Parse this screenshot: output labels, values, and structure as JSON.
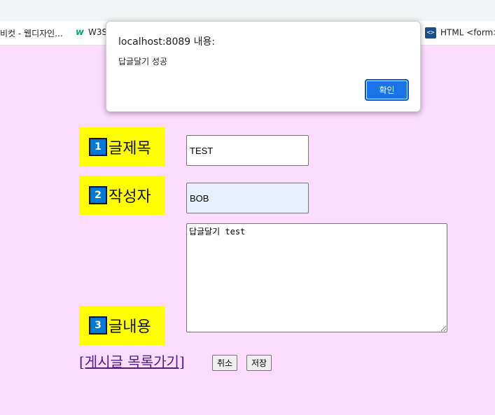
{
  "browser": {
    "bookmarks": [
      {
        "label": "비컷 - 웹디자인..."
      },
      {
        "label": "W3S",
        "icon": "w3schools-icon"
      },
      {
        "label": "HTML <form>",
        "icon": "code-icon"
      }
    ]
  },
  "form": {
    "fields": [
      {
        "num": "1",
        "label": "글제목",
        "value": "TEST"
      },
      {
        "num": "2",
        "label": "작성자",
        "value": "BOB"
      },
      {
        "num": "3",
        "label": "글내용",
        "value": "답글달기 test"
      }
    ],
    "list_link": "[게시글 목록가기]",
    "cancel_label": "취소",
    "save_label": "저장"
  },
  "dialog": {
    "title": "localhost:8089 내용:",
    "message": "답글달기 성공",
    "ok_label": "확인"
  },
  "colors": {
    "page_bg": "#fcdcff",
    "label_bg": "#ffff00",
    "badge_bg": "#0078d7",
    "ok_button": "#1a73e8"
  }
}
